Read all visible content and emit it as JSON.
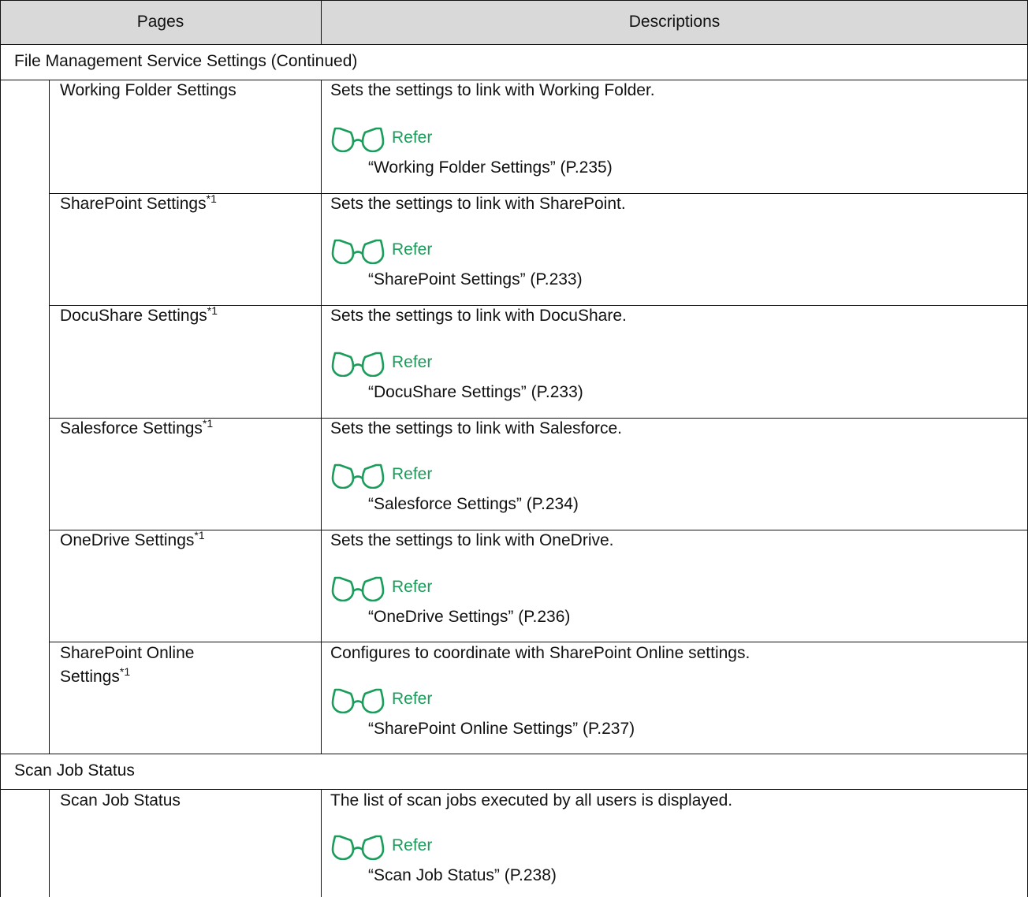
{
  "header": {
    "pages": "Pages",
    "descriptions": "Descriptions"
  },
  "sections": [
    {
      "label": "File Management Service Settings (Continued)"
    },
    {
      "label": "Scan Job Status"
    }
  ],
  "rows": [
    {
      "page": "Working Folder Settings",
      "page_line2": "",
      "footnote": "",
      "description": "Sets the settings to link with Working Folder.",
      "refer_label": "Refer",
      "refer_target": "“Working Folder Settings” (P.235)"
    },
    {
      "page": "SharePoint Settings",
      "page_line2": "",
      "footnote": "*1",
      "description": "Sets the settings to link with SharePoint.",
      "refer_label": "Refer",
      "refer_target": "“SharePoint Settings” (P.233)"
    },
    {
      "page": "DocuShare Settings",
      "page_line2": "",
      "footnote": "*1",
      "description": "Sets the settings to link with DocuShare.",
      "refer_label": "Refer",
      "refer_target": "“DocuShare Settings” (P.233)"
    },
    {
      "page": "Salesforce Settings",
      "page_line2": "",
      "footnote": "*1",
      "description": "Sets the settings to link with Salesforce.",
      "refer_label": "Refer",
      "refer_target": "“Salesforce Settings” (P.234)"
    },
    {
      "page": "OneDrive Settings",
      "page_line2": "",
      "footnote": "*1",
      "description": "Sets the settings to link with OneDrive.",
      "refer_label": "Refer",
      "refer_target": "“OneDrive Settings” (P.236)"
    },
    {
      "page": "SharePoint Online",
      "page_line2": "Settings",
      "footnote": "*1",
      "description": "Configures to coordinate with SharePoint Online settings.",
      "refer_label": "Refer",
      "refer_target": "“SharePoint Online Settings” (P.237)"
    },
    {
      "page": "Scan Job Status",
      "page_line2": "",
      "footnote": "",
      "description": "The list of scan jobs executed by all users is displayed.",
      "refer_label": "Refer",
      "refer_target": "“Scan Job Status” (P.238)"
    }
  ],
  "icons": {
    "refer": "glasses-icon"
  },
  "colors": {
    "refer": "#1a9c5a",
    "header_bg": "#d9d9d9",
    "border": "#111111"
  }
}
